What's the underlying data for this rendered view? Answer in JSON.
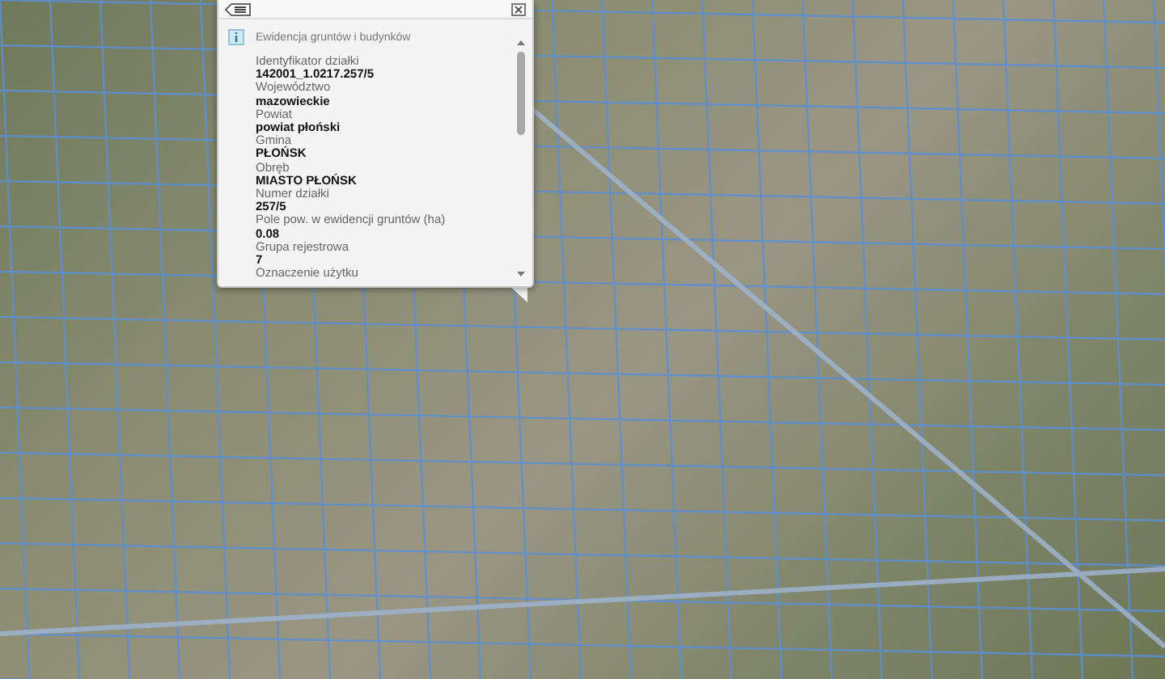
{
  "popup": {
    "title": "Ewidencja gruntów i budynków",
    "fields": [
      {
        "label": "Identyfikator działki",
        "value": "142001_1.0217.257/5"
      },
      {
        "label": "Województwo",
        "value": "mazowieckie"
      },
      {
        "label": "Powiat",
        "value": "powiat płoński"
      },
      {
        "label": "Gmina",
        "value": "PŁOŃSK"
      },
      {
        "label": "Obręb",
        "value": "MIASTO PŁOŃSK"
      },
      {
        "label": "Numer działki",
        "value": "257/5"
      },
      {
        "label": "Pole pow. w ewidencji gruntów (ha)",
        "value": "0.08"
      },
      {
        "label": "Grupa rejestrowa",
        "value": "7"
      },
      {
        "label": "Oznaczenie użytku"
      }
    ]
  }
}
